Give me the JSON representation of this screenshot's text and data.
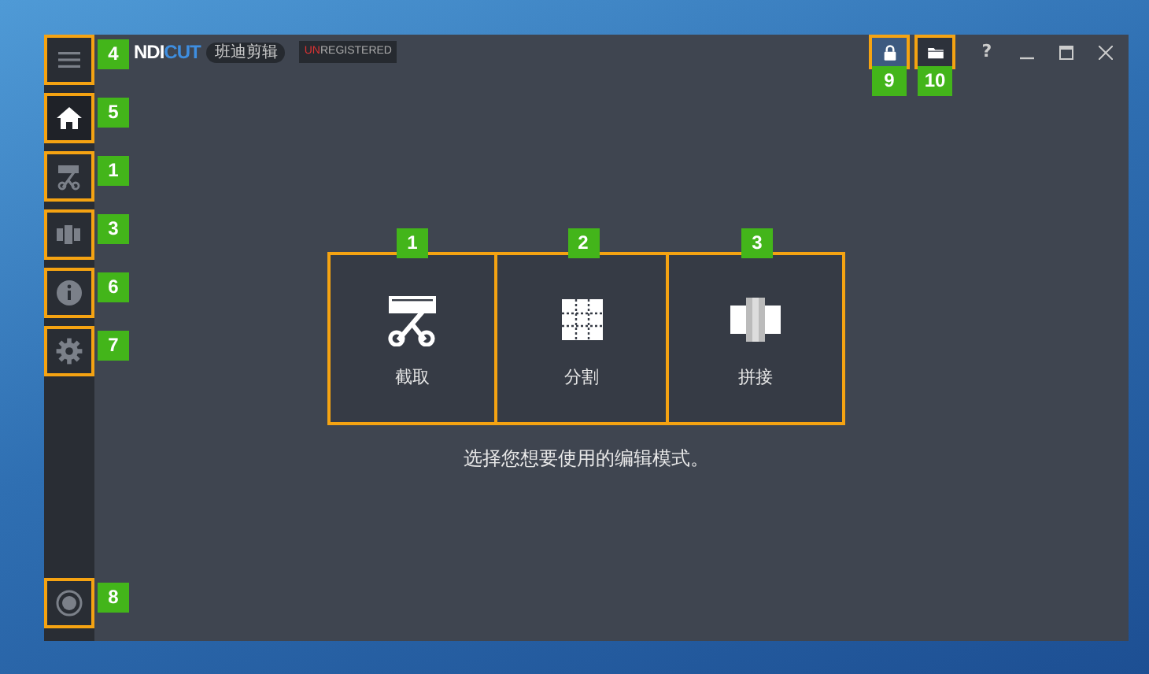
{
  "title_bar": {
    "logo": {
      "part_1": "NDI",
      "part_2": "CUT"
    },
    "app_name_badge": "班迪剪辑",
    "registration_badge": {
      "part_1": "UN",
      "part_2": "REGISTERED"
    },
    "tool_buttons": [
      {
        "kind": "lock",
        "highlighted": true,
        "callout": "9"
      },
      {
        "kind": "folder",
        "highlighted": false,
        "callout": "10"
      }
    ],
    "window_controls": [
      {
        "kind": "help",
        "text": "?"
      },
      {
        "kind": "minimize"
      },
      {
        "kind": "maximize"
      },
      {
        "kind": "close"
      }
    ]
  },
  "sidebar": {
    "items": [
      {
        "kind": "menu",
        "selected": false,
        "callout": "4"
      },
      {
        "kind": "home",
        "selected": true,
        "callout": "5"
      },
      {
        "kind": "trim",
        "selected": false,
        "callout": "1"
      },
      {
        "kind": "join",
        "selected": false,
        "callout": "3"
      },
      {
        "kind": "info",
        "selected": false,
        "callout": "6"
      },
      {
        "kind": "settings",
        "selected": false,
        "callout": "7"
      }
    ],
    "bottom_item": {
      "kind": "record",
      "selected": false,
      "callout": "8"
    }
  },
  "modes": [
    {
      "kind": "trim",
      "label": "截取",
      "callout": "1"
    },
    {
      "kind": "split",
      "label": "分割",
      "callout": "2"
    },
    {
      "kind": "join",
      "label": "拼接",
      "callout": "3"
    }
  ],
  "hint": "选择您想要使用的编辑模式。"
}
